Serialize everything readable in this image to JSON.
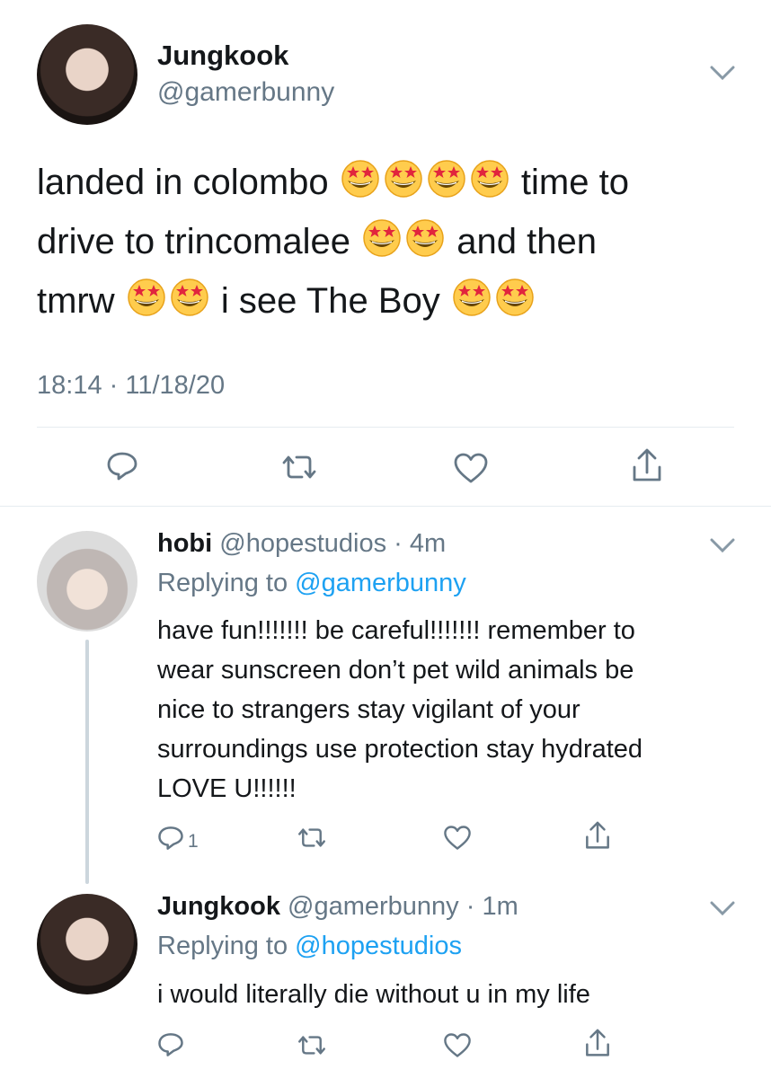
{
  "main_tweet": {
    "author_name": "Jungkook",
    "handle": "@gamerbunny",
    "lines": [
      {
        "text_before": "landed in colombo",
        "emoji_count": 4,
        "text_after": "time to"
      },
      {
        "text_before": "drive to trincomalee",
        "emoji_count": 2,
        "text_after": "and then"
      },
      {
        "text_before": "tmrw",
        "emoji_count": 2,
        "text_after": "i see The Boy",
        "emoji_trailing": 2
      }
    ],
    "emoji_icon": "star-struck-emoji",
    "timestamp": "18:14 · 11/18/20"
  },
  "replies": [
    {
      "author_name": "hobi",
      "handle": "@hopestudios",
      "time": "4m",
      "replying_label": "Replying to",
      "replying_to": "@gamerbunny",
      "lines": [
        "have fun!!!!!!! be careful!!!!!!! remember to",
        "wear sunscreen don’t pet wild animals be",
        "nice to strangers stay vigilant of your",
        "surroundings use protection stay hydrated",
        "LOVE U!!!!!!"
      ],
      "reply_count": "1"
    },
    {
      "author_name": "Jungkook",
      "handle": "@gamerbunny",
      "time": "1m",
      "replying_label": "Replying to",
      "replying_to": "@hopestudios",
      "lines": [
        "i would literally die without u in my life"
      ],
      "reply_count": ""
    }
  ],
  "colors": {
    "link": "#1da1f2",
    "muted": "#657786",
    "text": "#14171a",
    "divider": "#e6ecf0"
  }
}
